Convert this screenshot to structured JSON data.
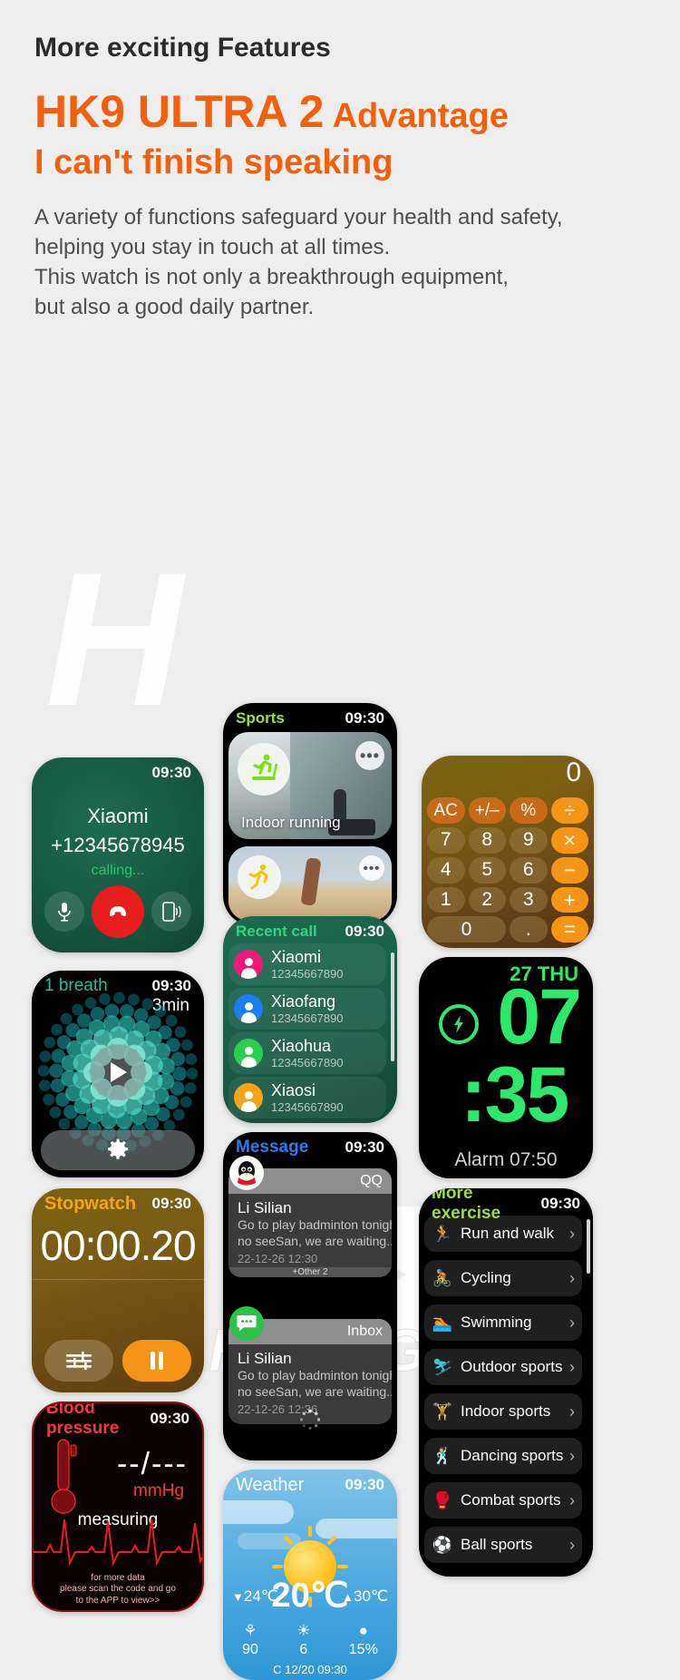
{
  "header": {
    "eyebrow": "More exciting Features",
    "title_strong": "HK9 ULTRA 2",
    "title_rest": " Advantage",
    "subtitle": "I can't finish speaking",
    "desc_line1": "A variety of functions safeguard your health and safety,",
    "desc_line2": "helping you stay in touch at all times.",
    "desc_line3": "This watch is not only a breakthrough equipment,",
    "desc_line4": "but also a good daily partner.",
    "accent": "#f2600c"
  },
  "watermark": {
    "mark": "H",
    "brand": "HUAHONG"
  },
  "calling": {
    "time": "09:30",
    "name": "Xiaomi",
    "number": "+12345678945",
    "state": "calling...",
    "mute_icon": "microphone-icon",
    "hangup_icon": "phone-hangup-icon",
    "speaker_icon": "speaker-phone-icon"
  },
  "sports": {
    "title": "Sports",
    "time": "09:30",
    "cards": [
      {
        "label": "Indoor running",
        "icon": "treadmill-runner-icon",
        "more": "•••"
      },
      {
        "label": "",
        "icon": "outdoor-runner-icon",
        "more": "•••"
      }
    ]
  },
  "calculator": {
    "display": "0",
    "keys": [
      {
        "label": "AC",
        "kind": "fn"
      },
      {
        "label": "+/–",
        "kind": "fn"
      },
      {
        "label": "%",
        "kind": "fn"
      },
      {
        "label": "÷",
        "kind": "op"
      },
      {
        "label": "7",
        "kind": "num"
      },
      {
        "label": "8",
        "kind": "num"
      },
      {
        "label": "9",
        "kind": "num"
      },
      {
        "label": "×",
        "kind": "op"
      },
      {
        "label": "4",
        "kind": "num"
      },
      {
        "label": "5",
        "kind": "num"
      },
      {
        "label": "6",
        "kind": "num"
      },
      {
        "label": "−",
        "kind": "op"
      },
      {
        "label": "1",
        "kind": "num"
      },
      {
        "label": "2",
        "kind": "num"
      },
      {
        "label": "3",
        "kind": "num"
      },
      {
        "label": "+",
        "kind": "op"
      },
      {
        "label": "0",
        "kind": "num wide"
      },
      {
        "label": ".",
        "kind": "num"
      },
      {
        "label": "=",
        "kind": "op"
      }
    ]
  },
  "breath": {
    "title": "1 breath",
    "time": "09:30",
    "duration": "3min",
    "play_icon": "play-icon",
    "gear_icon": "gear-icon"
  },
  "recent_call": {
    "title": "Recent call",
    "time": "09:30",
    "contacts": [
      {
        "name": "Xiaomi",
        "number": "12345667890",
        "color": "#f0187a"
      },
      {
        "name": "Xiaofang",
        "number": "12345667890",
        "color": "#1b7ef2"
      },
      {
        "name": "Xiaohua",
        "number": "12345667890",
        "color": "#2bd14e"
      },
      {
        "name": "Xiaosi",
        "number": "12345667890",
        "color": "#f5a31b"
      }
    ]
  },
  "clock": {
    "date": "27 THU",
    "hour": "07",
    "minute": ":35",
    "alarm": "Alarm 07:50",
    "charge_icon": "lightning-bolt-icon",
    "color": "#2ee86b"
  },
  "stopwatch": {
    "title": "Stopwatch",
    "time": "09:30",
    "value": "00:00.20",
    "lap_icon": "lap-icon",
    "pause_icon": "pause-icon"
  },
  "message": {
    "title": "Message",
    "time": "09:30",
    "threads": [
      {
        "app": "QQ",
        "app_icon": "qq-penguin-icon",
        "from": "Li Silian",
        "line1": "Go to play badminton tonight,",
        "line2": "no seeSan, we are waiting...",
        "date": "22-12-26  12:30",
        "other": "+Other 2"
      },
      {
        "app": "Inbox",
        "app_icon": "sms-bubble-icon",
        "from": "Li Silian",
        "line1": "Go to play badminton tonight,",
        "line2": "no seeSan, we are waiting...",
        "date": "22-12-26  12:36",
        "other": ""
      }
    ],
    "loading_icon": "spinner-icon"
  },
  "more_exercise": {
    "title": "More exercise",
    "time": "09:30",
    "items": [
      {
        "label": "Run and walk",
        "icon": "runner-icon",
        "color": "#e8e20f"
      },
      {
        "label": "Cycling",
        "icon": "cyclist-icon",
        "color": "#f59518"
      },
      {
        "label": "Swimming",
        "icon": "swimmer-icon",
        "color": "#f5c518"
      },
      {
        "label": "Outdoor sports",
        "icon": "outdoor-sports-icon",
        "color": "#34c7e8"
      },
      {
        "label": "Indoor sports",
        "icon": "indoor-sports-icon",
        "color": "#f5a318"
      },
      {
        "label": "Dancing sports",
        "icon": "dancer-icon",
        "color": "#e8e20f"
      },
      {
        "label": "Combat sports",
        "icon": "boxer-icon",
        "color": "#2bd14e"
      },
      {
        "label": "Ball sports",
        "icon": "ball-sports-icon",
        "color": "#e8e20f"
      }
    ],
    "chevron": "›"
  },
  "blood_pressure": {
    "title": "Blood pressure",
    "time": "09:30",
    "value": "--/---",
    "unit": "mmHg",
    "status": "measuring",
    "note_line1": "for more data",
    "note_line2": "please scan the code and go",
    "note_line3": "to the APP to view>>",
    "thermo_icon": "thermometer-icon",
    "ecg_icon": "ecg-waveform-icon"
  },
  "weather": {
    "title": "Weather",
    "time": "09:30",
    "temp": "20℃",
    "low": "24℃",
    "high": "30℃",
    "low_arrow": "▼",
    "high_arrow": "▲",
    "sun_icon": "sun-icon",
    "stats": [
      {
        "icon": "wind-icon",
        "glyph": "⚘",
        "value": "90"
      },
      {
        "icon": "uv-icon",
        "glyph": "☀",
        "value": "6"
      },
      {
        "icon": "humidity-icon",
        "glyph": "●",
        "value": "15%"
      }
    ],
    "footer": "C  12/20  09:30"
  }
}
